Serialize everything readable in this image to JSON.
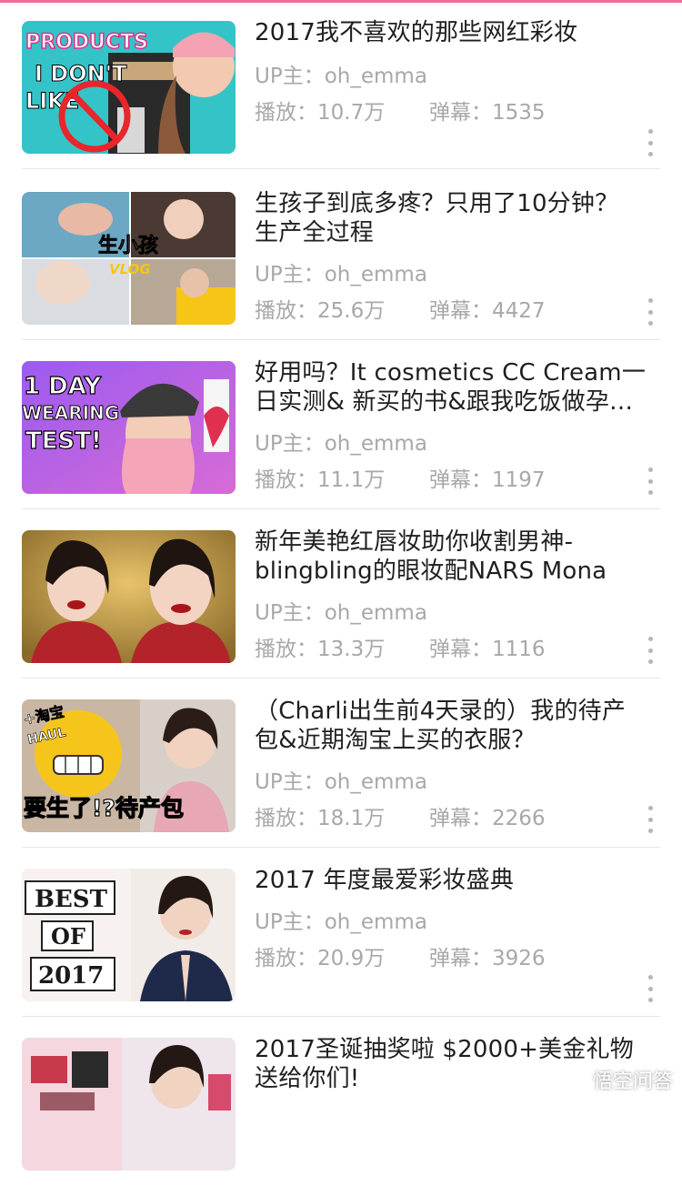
{
  "videos": [
    {
      "title_lines": [
        "2017我不喜欢的那些网红彩妆"
      ],
      "uploader": "UP主：oh_emma",
      "plays": "播放：10.7万",
      "danmaku": "弹幕：1535",
      "thumb_text": [
        "PRODUCTS",
        "I DON'T",
        "LIKE"
      ]
    },
    {
      "title_lines": [
        "生孩子到底多疼？只用了10分钟？",
        "生产全过程"
      ],
      "uploader": "UP主：oh_emma",
      "plays": "播放：25.6万",
      "danmaku": "弹幕：4427",
      "thumb_text": [
        "生小孩",
        "VLOG"
      ]
    },
    {
      "title_lines": [
        "好用吗？It cosmetics CC Cream一",
        "日实测& 新买的书&跟我吃饭做孕…"
      ],
      "uploader": "UP主：oh_emma",
      "plays": "播放：11.1万",
      "danmaku": "弹幕：1197",
      "thumb_text": [
        "1 DAY",
        "WEARING",
        "TEST!"
      ]
    },
    {
      "title_lines": [
        "新年美艳红唇妆助你收割男神-",
        "blingbling的眼妆配NARS Mona"
      ],
      "uploader": "UP主：oh_emma",
      "plays": "播放：13.3万",
      "danmaku": "弹幕：1116",
      "thumb_text": []
    },
    {
      "title_lines": [
        "（Charli出生前4天录的）我的待产",
        "包&近期淘宝上买的衣服？"
      ],
      "uploader": "UP主：oh_emma",
      "plays": "播放：18.1万",
      "danmaku": "弹幕：2266",
      "thumb_text": [
        "+淘宝",
        "HAUL",
        "要生了!?待产包"
      ]
    },
    {
      "title_lines": [
        "2017 年度最爱彩妆盛典"
      ],
      "uploader": "UP主：oh_emma",
      "plays": "播放：20.9万",
      "danmaku": "弹幕：3926",
      "thumb_text": [
        "BEST",
        "OF",
        "2017"
      ]
    },
    {
      "title_lines": [
        "2017圣诞抽奖啦 $2000+美金礼物",
        "送给你们!"
      ],
      "uploader": "",
      "plays": "",
      "danmaku": "",
      "thumb_text": []
    }
  ],
  "watermark": "悟空问答",
  "colors": {
    "accent": "#f06b9b",
    "meta_gray": "#a8a8a8",
    "title": "#1f1f1f"
  },
  "icons": {
    "more": "more-vertical-icon",
    "watermark_logo": "wukong-logo-icon"
  }
}
